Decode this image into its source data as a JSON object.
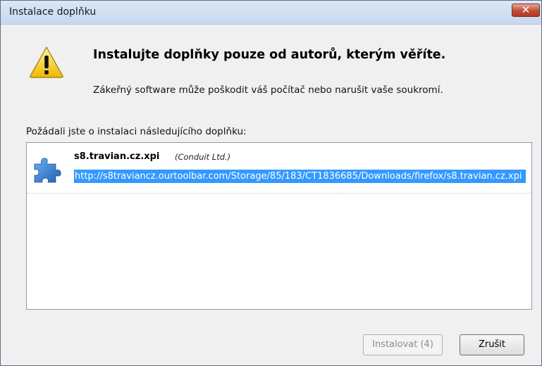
{
  "window": {
    "title": "Instalace doplňku",
    "close_label": "✕"
  },
  "warning": {
    "icon": "warning-icon",
    "heading": "Instalujte doplňky pouze od autorů, kterým věříte.",
    "subtext": "Zákeřný software může poškodit váš počítač nebo narušit vaše soukromí."
  },
  "list": {
    "label": "Požádali jste o instalaci následujícího doplňku:",
    "items": [
      {
        "icon": "puzzle-piece-icon",
        "name": "s8.travian.cz.xpi",
        "author": "(Conduit Ltd.)",
        "url": "http://s8traviancz.ourtoolbar.com/Storage/85/183/CT1836685/Downloads/firefox/s8.travian.cz.xpi"
      }
    ]
  },
  "buttons": {
    "install_label": "Instalovat (4)",
    "cancel_label": "Zrušit"
  },
  "colors": {
    "selection": "#3399ff",
    "close_button": "#c24c37",
    "icon_blue": "#2a6fc8",
    "warning_yellow": "#f5c400"
  }
}
